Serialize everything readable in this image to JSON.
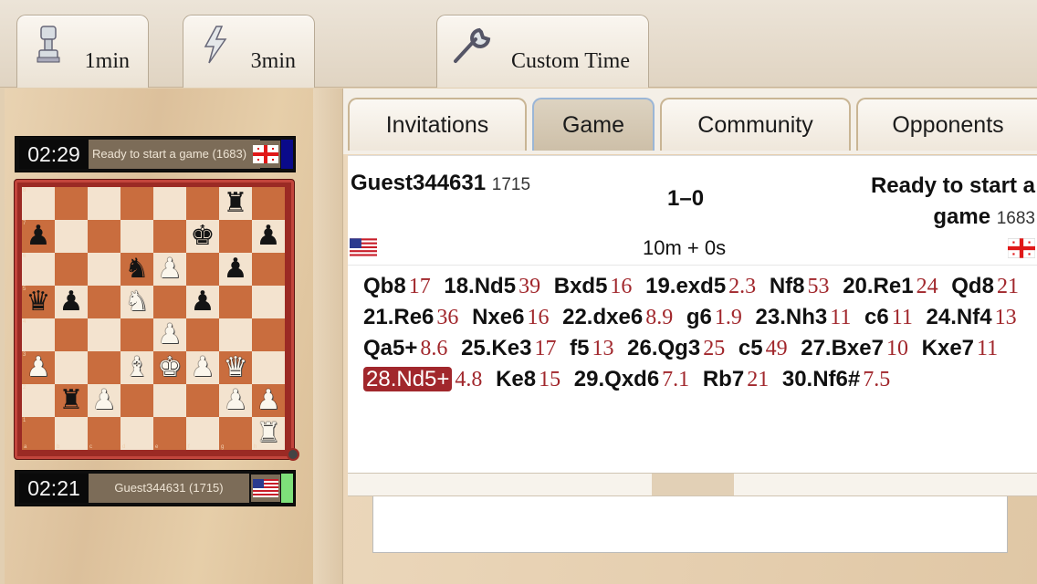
{
  "toolbar": {
    "buttons": [
      {
        "label": "1min",
        "icon": "pawn-icon"
      },
      {
        "label": "3min",
        "icon": "lightning-icon"
      },
      {
        "label": "Custom Time",
        "icon": "wrench-icon"
      }
    ]
  },
  "tabs": [
    "Invitations",
    "Game",
    "Community",
    "Opponents"
  ],
  "active_tab": "Game",
  "game": {
    "white": {
      "name": "Guest344631",
      "rating": "1715",
      "flag": "us-flag-icon"
    },
    "black": {
      "name": "Ready to start a game",
      "rating": "1683",
      "flag": "georgia-flag-icon"
    },
    "result": "1–0",
    "time_control": "10m + 0s"
  },
  "clocks": {
    "top": {
      "time": "02:29",
      "label": "Ready to start a game (1683)",
      "flag": "georgia-flag-icon",
      "turn_color": "#0a0a8a"
    },
    "bottom": {
      "time": "02:21",
      "label": "Guest344631 (1715)",
      "flag": "us-flag-icon",
      "turn_color": "#7ee07a"
    }
  },
  "board": {
    "rows": [
      "......r.",
      "p....k.p",
      "...nP.p.",
      "qp.N.p..",
      "....P...",
      "P..BKPQ.",
      ".rP...PP",
      "...... R"
    ],
    "ranks": [
      "8",
      "7",
      "6",
      "5",
      "4",
      "3",
      "2",
      "1"
    ],
    "files": [
      "a",
      "b",
      "c",
      "d",
      "e",
      "f",
      "g",
      "h"
    ]
  },
  "moves": [
    {
      "m": "Qb8",
      "t": "17"
    },
    {
      "m": "18.Nd5",
      "t": "39"
    },
    {
      "m": "Bxd5",
      "t": "16"
    },
    {
      "m": "19.exd5",
      "t": "2.3"
    },
    {
      "m": "Nf8",
      "t": "53"
    },
    {
      "m": "20.Re1",
      "t": "24"
    },
    {
      "m": "Qd8",
      "t": "21"
    },
    {
      "m": "21.Re6",
      "t": "36"
    },
    {
      "m": "Nxe6",
      "t": "16"
    },
    {
      "m": "22.dxe6",
      "t": "8.9"
    },
    {
      "m": "g6",
      "t": "1.9"
    },
    {
      "m": "23.Nh3",
      "t": "11"
    },
    {
      "m": "c6",
      "t": "11"
    },
    {
      "m": "24.Nf4",
      "t": "13"
    },
    {
      "m": "Qa5+",
      "t": "8.6"
    },
    {
      "m": "25.Ke3",
      "t": "17"
    },
    {
      "m": "f5",
      "t": "13"
    },
    {
      "m": "26.Qg3",
      "t": "25"
    },
    {
      "m": "c5",
      "t": "49"
    },
    {
      "m": "27.Bxe7",
      "t": "10"
    },
    {
      "m": "Kxe7",
      "t": "11"
    },
    {
      "m": "28.Nd5+",
      "t": "4.8",
      "highlight": true
    },
    {
      "m": "Ke8",
      "t": "15"
    },
    {
      "m": "29.Qxd6",
      "t": "7.1"
    },
    {
      "m": "Rb7",
      "t": "21"
    },
    {
      "m": "30.Nf6#",
      "t": "7.5"
    }
  ],
  "colors": {
    "accent": "#a1272c",
    "board_dark": "#c96d3e",
    "board_light": "#f3e3cf",
    "frame": "#9b2a24"
  }
}
